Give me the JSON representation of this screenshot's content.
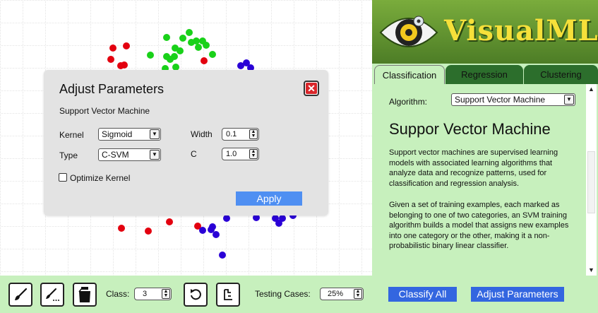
{
  "modal": {
    "title": "Adjust Parameters",
    "algorithm_name": "Support Vector Machine",
    "kernel_label": "Kernel",
    "kernel_value": "Sigmoid",
    "type_label": "Type",
    "type_value": "C-SVM",
    "width_label": "Width",
    "width_value": "0.1",
    "c_label": "C",
    "c_value": "1.0",
    "optimize_label": "Optimize Kernel",
    "optimize_checked": false,
    "apply_label": "Apply"
  },
  "toolbar": {
    "class_label": "Class:",
    "class_value": "3",
    "testing_label": "Testing Cases:",
    "testing_value": "25%",
    "tools": [
      "brush-icon",
      "multi-brush-icon",
      "paint-bucket-icon",
      "undo-icon",
      "clear-icon"
    ]
  },
  "logo": {
    "name": "VisualML"
  },
  "tabs": [
    {
      "label": "Classification",
      "active": true
    },
    {
      "label": "Regression",
      "active": false
    },
    {
      "label": "Clustering",
      "active": false
    }
  ],
  "panel": {
    "algorithm_label": "Algorithm:",
    "algorithm_value": "Support Vector Machine",
    "heading": "Suppor Vector Machine",
    "para1": "Support vector machines are supervised learning models with associated learning algorithms that analyze data and recognize patterns, used for classification and regression analysis.",
    "para2": "Given a set of training examples, each marked as belonging to one of two categories, an SVM training algorithm builds a model that assigns new examples into one category or the other, making it a non-probabilistic binary linear classifier."
  },
  "buttons": {
    "classify_all": "Classify All",
    "adjust_parameters": "Adjust Parameters"
  },
  "colors": {
    "class1": "#e3000f",
    "class2": "#19d119",
    "class3": "#2a00d6",
    "accent_blue": "#3366e0",
    "panel_green": "#c7f0bd",
    "tab_green": "#2c6e2c"
  }
}
